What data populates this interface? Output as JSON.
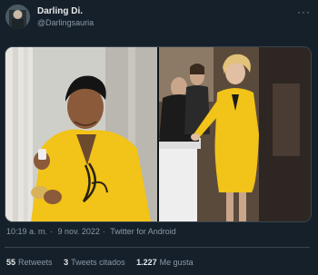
{
  "tweet": {
    "author": {
      "display_name": "Darling Di.",
      "handle": "@Darlingsauria"
    },
    "more_icon": "more-horizontal-icon",
    "timestamp": {
      "time": "10:19 a. m.",
      "separator": "·",
      "date": "9 nov. 2022",
      "separator2": "·",
      "source": "Twitter for Android"
    },
    "stats": {
      "retweets_count": "55",
      "retweets_label": "Retweets",
      "quotes_count": "3",
      "quotes_label": "Tweets citados",
      "likes_count": "1.227",
      "likes_label": "Me gusta"
    }
  },
  "colors": {
    "background": "#15202b",
    "primary_text": "#e7e9ea",
    "secondary_text": "#8b98a5",
    "border": "#38444d",
    "shirt_yellow": "#f2c318"
  }
}
